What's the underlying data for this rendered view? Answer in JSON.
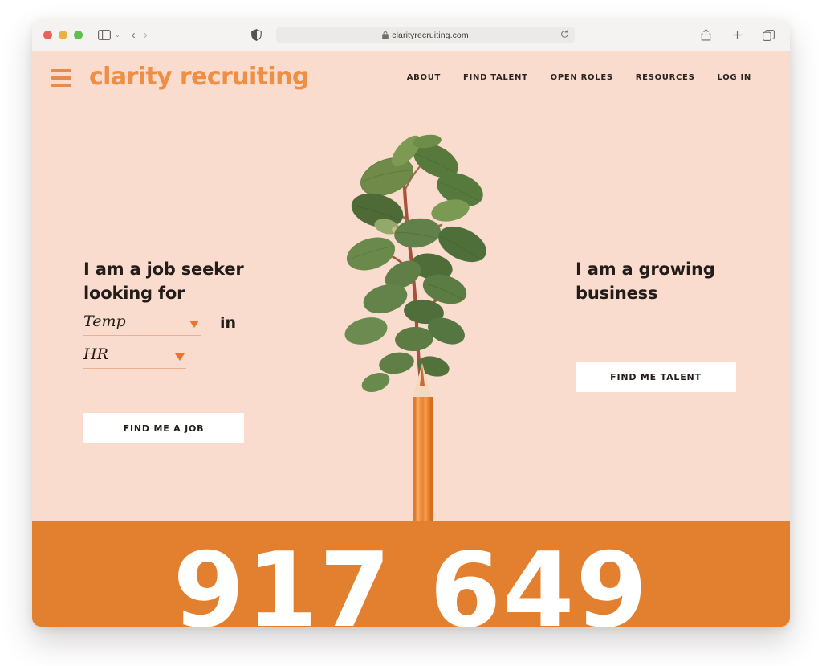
{
  "browser": {
    "traffic_lights": [
      "close",
      "minimize",
      "maximize"
    ],
    "sidebar_icon": "sidebar-icon",
    "sidebar_chevron": "⌄",
    "back_arrow": "‹",
    "forward_arrow": "›",
    "shield_icon": "privacy-shield-icon",
    "lock_icon": "lock-icon",
    "url": "clarityrecruiting.com",
    "reload_icon": "reload-icon",
    "share_icon": "share-icon",
    "new_tab_icon": "plus-icon",
    "tabs_icon": "tabs-overview-icon"
  },
  "site": {
    "menu_icon": "hamburger-menu-icon",
    "brand": "clarity recruiting",
    "nav": [
      {
        "label": "ABOUT"
      },
      {
        "label": "FIND TALENT"
      },
      {
        "label": "OPEN ROLES"
      },
      {
        "label": "RESOURCES"
      },
      {
        "label": "LOG IN"
      }
    ]
  },
  "hero": {
    "job_seeker": {
      "headline_line1": "I am a job seeker",
      "headline_line2": "looking for",
      "type_select": {
        "value": "Temp",
        "caret": "dropdown-caret-icon"
      },
      "connector": "in",
      "field_select": {
        "value": "HR",
        "caret": "dropdown-caret-icon"
      },
      "cta_label": "FIND ME A JOB"
    },
    "business": {
      "headline_line1": "I am a growing",
      "headline_line2": "business",
      "cta_label": "FIND ME TALENT"
    },
    "artwork": {
      "name": "pencil-sprouting-plant-illustration"
    }
  },
  "band": {
    "big_number": "917 649"
  },
  "colors": {
    "page_background": "#f9dccd",
    "brand_orange": "#ef8f45",
    "band_orange": "#e3802f",
    "accent_caret": "#e8752a",
    "text_dark": "#231c19",
    "button_white": "#ffffff"
  }
}
